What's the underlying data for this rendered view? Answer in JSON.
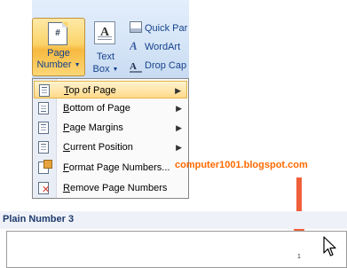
{
  "ribbon": {
    "page_number": {
      "line1": "Page",
      "line2": "Number",
      "icon_glyph": "#"
    },
    "text_box": {
      "line1": "Text",
      "line2": "Box",
      "icon_glyph": "A"
    },
    "quick_parts": "Quick Par",
    "wordart": "WordArt",
    "drop_cap": "Drop Cap",
    "icons": {
      "page_number": "page-number-icon",
      "text_box": "text-box-icon",
      "quick_parts": "quick-parts-icon",
      "wordart": "wordart-icon",
      "drop_cap": "drop-cap-icon"
    }
  },
  "menu": {
    "items": [
      {
        "accel": "T",
        "rest": "op of Page",
        "submenu": true,
        "highlighted": true,
        "icon": "top-of-page-icon"
      },
      {
        "accel": "B",
        "rest": "ottom of Page",
        "submenu": true,
        "highlighted": false,
        "icon": "bottom-of-page-icon"
      },
      {
        "accel": "P",
        "rest": "age Margins",
        "submenu": true,
        "highlighted": false,
        "icon": "page-margins-icon"
      },
      {
        "accel": "C",
        "rest": "urrent Position",
        "submenu": true,
        "highlighted": false,
        "icon": "current-position-icon"
      },
      {
        "accel": "F",
        "rest": "ormat Page Numbers...",
        "submenu": false,
        "highlighted": false,
        "icon": "format-page-numbers-icon"
      },
      {
        "accel": "R",
        "rest": "emove Page Numbers",
        "submenu": false,
        "highlighted": false,
        "icon": "remove-page-numbers-icon"
      }
    ],
    "submenu_glyph": "▶"
  },
  "watermark": "computer1001.blogspot.com",
  "gallery": {
    "title": "Plain Number 3",
    "page_number": "1"
  },
  "colors": {
    "accent_orange": "#ef5f3a",
    "ribbon_text": "#15428b",
    "highlight": "#ffd98a"
  }
}
